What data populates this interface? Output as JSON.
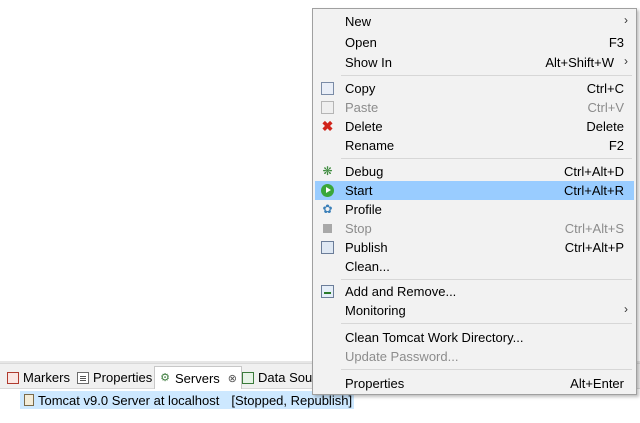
{
  "views": {
    "tabs": [
      {
        "label": "Markers",
        "icon": "markers-icon"
      },
      {
        "label": "Properties",
        "icon": "properties-icon"
      },
      {
        "label": "Servers",
        "icon": "servers-icon",
        "active": true,
        "close": "⊗"
      },
      {
        "label": "Data Sou",
        "icon": "data-source-icon"
      }
    ]
  },
  "servers": {
    "row": {
      "name": "Tomcat v9.0 Server at localhost",
      "status": "[Stopped, Republish]"
    }
  },
  "menu": {
    "submenu_arrow": "›",
    "items": [
      {
        "label": "New",
        "accel": ""
      },
      {
        "label": "Open",
        "accel": "F3"
      },
      {
        "label": "Show In",
        "accel": "Alt+Shift+W"
      },
      {
        "label": "Copy",
        "accel": "Ctrl+C"
      },
      {
        "label": "Paste",
        "accel": "Ctrl+V"
      },
      {
        "label": "Delete",
        "accel": "Delete"
      },
      {
        "label": "Rename",
        "accel": "F2"
      },
      {
        "label": "Debug",
        "accel": "Ctrl+Alt+D"
      },
      {
        "label": "Start",
        "accel": "Ctrl+Alt+R"
      },
      {
        "label": "Profile",
        "accel": ""
      },
      {
        "label": "Stop",
        "accel": "Ctrl+Alt+S"
      },
      {
        "label": "Publish",
        "accel": "Ctrl+Alt+P"
      },
      {
        "label": "Clean...",
        "accel": ""
      },
      {
        "label": "Add and Remove...",
        "accel": ""
      },
      {
        "label": "Monitoring",
        "accel": ""
      },
      {
        "label": "Clean Tomcat Work Directory...",
        "accel": ""
      },
      {
        "label": "Update Password...",
        "accel": ""
      },
      {
        "label": "Properties",
        "accel": "Alt+Enter"
      }
    ]
  },
  "colors": {
    "highlight": "#99ccff",
    "selection": "#cde8ff",
    "disabled_text": "#8c8c8c",
    "delete_icon": "#d0241b"
  }
}
